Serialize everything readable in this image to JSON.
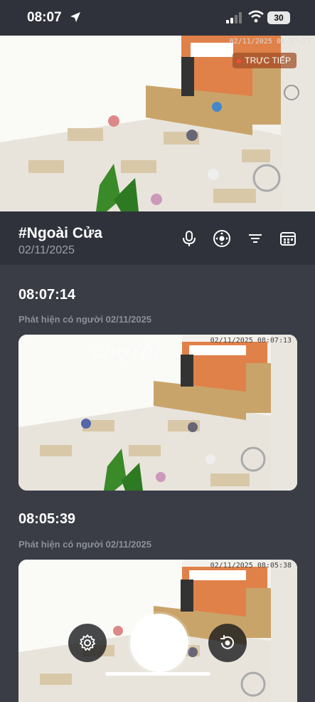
{
  "status_bar": {
    "time": "08:07",
    "battery": "30"
  },
  "live": {
    "badge": "TRỰC TIẾP",
    "timestamp": "02/11/2025 08:07:21"
  },
  "camera": {
    "name": "#Ngoài Cửa",
    "date": "02/11/2025"
  },
  "header_icons": [
    "microphone-icon",
    "ptz-control-icon",
    "filter-icon",
    "calendar-icon"
  ],
  "events": [
    {
      "time": "08:07:14",
      "description": "Phát hiện có người 02/11/2025",
      "stamp": "02/11/2025 08:07:13"
    },
    {
      "time": "08:05:39",
      "description": "Phát hiện có người 02/11/2025",
      "stamp": "02/11/2025 08:05:38"
    }
  ],
  "watermark": "chợTốt",
  "colors": {
    "background": "#3a3d46",
    "header": "#2f323a",
    "accent_live": "#ff4a3a",
    "wall_orange": "#e0814a"
  }
}
